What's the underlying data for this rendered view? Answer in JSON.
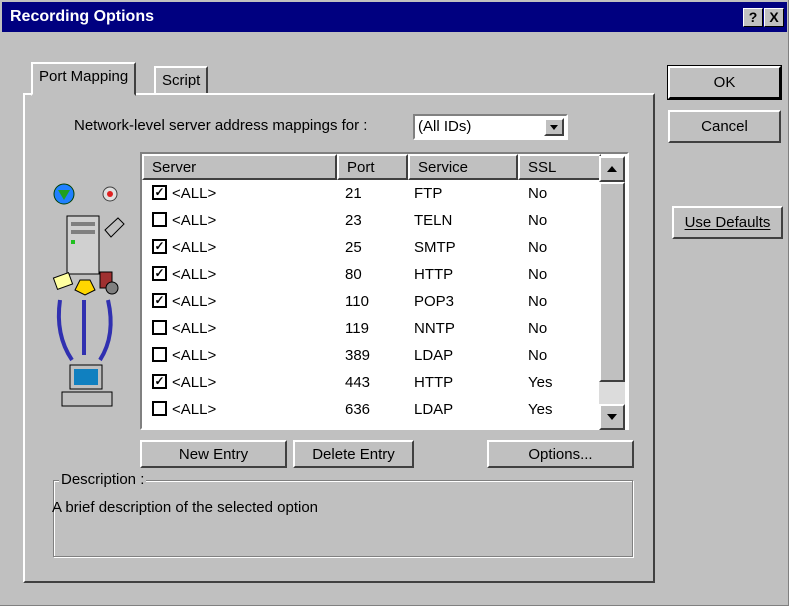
{
  "title": "Recording Options",
  "title_buttons": {
    "help": "?",
    "close": "X"
  },
  "tabs": [
    {
      "label": "Port Mapping"
    },
    {
      "label": "Script"
    }
  ],
  "mapping_label": "Network-level server address mappings for :",
  "mapping_select": {
    "value": "(All IDs)"
  },
  "table": {
    "headers": {
      "server": "Server",
      "port": "Port",
      "service": "Service",
      "ssl": "SSL"
    },
    "rows": [
      {
        "checked": true,
        "server": "<ALL>",
        "port": "21",
        "service": "FTP",
        "ssl": "No"
      },
      {
        "checked": false,
        "server": "<ALL>",
        "port": "23",
        "service": "TELN",
        "ssl": "No"
      },
      {
        "checked": true,
        "server": "<ALL>",
        "port": "25",
        "service": "SMTP",
        "ssl": "No"
      },
      {
        "checked": true,
        "server": "<ALL>",
        "port": "80",
        "service": "HTTP",
        "ssl": "No"
      },
      {
        "checked": true,
        "server": "<ALL>",
        "port": "110",
        "service": "POP3",
        "ssl": "No"
      },
      {
        "checked": false,
        "server": "<ALL>",
        "port": "119",
        "service": "NNTP",
        "ssl": "No"
      },
      {
        "checked": false,
        "server": "<ALL>",
        "port": "389",
        "service": "LDAP",
        "ssl": "No"
      },
      {
        "checked": true,
        "server": "<ALL>",
        "port": "443",
        "service": "HTTP",
        "ssl": "Yes"
      },
      {
        "checked": false,
        "server": "<ALL>",
        "port": "636",
        "service": "LDAP",
        "ssl": "Yes"
      }
    ]
  },
  "buttons": {
    "new_entry": "New Entry",
    "delete_entry": "Delete Entry",
    "options": "Options...",
    "ok": "OK",
    "cancel": "Cancel",
    "use_defaults": "Use Defaults"
  },
  "description": {
    "label": "Description :",
    "text": "A brief description of the selected option"
  },
  "icons": {
    "illustration": "network-illustration-icon",
    "dropdown": "dropdown-arrow-icon",
    "scroll_up": "scroll-up-icon",
    "scroll_down": "scroll-down-icon"
  },
  "colors": {
    "titlebar": "#000080",
    "face": "#c0c0c0"
  }
}
